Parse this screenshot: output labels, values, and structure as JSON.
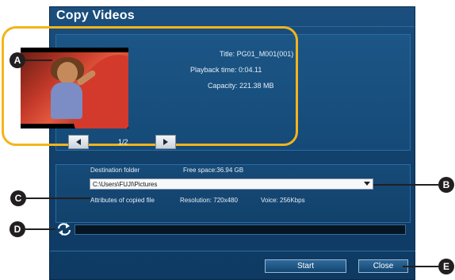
{
  "window": {
    "title": "Copy Videos"
  },
  "preview": {
    "title_text": "Title: PG01_M001(001)",
    "playback_text": "Playback time: 0:04.11",
    "capacity_text": "Capacity: 221.38 MB",
    "page_indicator": "1/2"
  },
  "destination": {
    "label": "Destination folder",
    "free_space": "Free space:36.94 GB",
    "path": "C:\\Users\\FUJI\\Pictures",
    "attributes_label": "Attributes of copied file",
    "resolution": "Resolution: 720x480",
    "voice": "Voice: 256Kbps"
  },
  "buttons": {
    "start": "Start",
    "close": "Close"
  },
  "markers": {
    "a": "A",
    "b": "B",
    "c": "C",
    "d": "D",
    "e": "E"
  },
  "progress": {
    "fraction": 0
  },
  "icons": {
    "prev": "left-triangle-icon",
    "next": "right-triangle-icon",
    "dropdown": "chevron-down-icon",
    "status": "recycle-arrows-icon"
  },
  "colors": {
    "highlight": "#f4b41a",
    "window_bg": "#134470",
    "marker": "#231f20"
  }
}
